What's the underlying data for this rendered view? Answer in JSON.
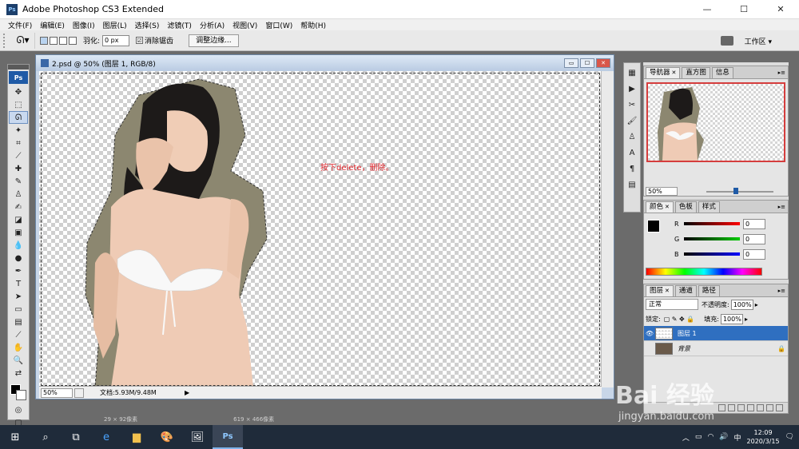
{
  "titlebar": {
    "app_title": "Adobe Photoshop CS3 Extended",
    "logo": "Ps",
    "minimize": "—",
    "maximize": "☐",
    "close": "✕"
  },
  "menu": [
    "文件(F)",
    "编辑(E)",
    "图像(I)",
    "图层(L)",
    "选择(S)",
    "滤镜(T)",
    "分析(A)",
    "视图(V)",
    "窗口(W)",
    "帮助(H)"
  ],
  "options": {
    "feather_label": "羽化:",
    "feather_value": "0 px",
    "antialias_label": "消除锯齿",
    "antialias_checked": "☑",
    "refine_edge": "调整边缘...",
    "workspace": "工作区 ▾"
  },
  "document": {
    "title": "2.psd @ 50% (图层 1, RGB/8)",
    "annotation": "按下delete，删除。",
    "zoom": "50%",
    "doc_info": "文档:5.93M/9.48M"
  },
  "panels": {
    "navigator": {
      "tabs": [
        "导航器",
        "直方图",
        "信息"
      ],
      "zoom": "50%"
    },
    "color": {
      "tabs": [
        "颜色",
        "色板",
        "样式"
      ],
      "channels": [
        {
          "label": "R",
          "value": "0",
          "color": "#cc0000"
        },
        {
          "label": "G",
          "value": "0",
          "color": "#00aa00"
        },
        {
          "label": "B",
          "value": "0",
          "color": "#0000cc"
        }
      ]
    },
    "layers": {
      "tabs": [
        "图层",
        "通道",
        "路径"
      ],
      "blend_mode": "正常",
      "opacity_label": "不透明度:",
      "opacity": "100%",
      "lock_label": "锁定:",
      "fill_label": "填充:",
      "fill": "100%",
      "items": [
        {
          "name": "图层 1",
          "visible": "👁"
        },
        {
          "name": "背景",
          "visible": ""
        }
      ]
    }
  },
  "ghost_bar": [
    "29 × 92像素",
    "619 × 466像素"
  ],
  "taskbar": {
    "ime": "中",
    "time": "12:09",
    "date": "2020/3/15"
  },
  "watermark": {
    "main": "Bai 经验",
    "sub": "jingyan.baidu.com"
  },
  "colors": {
    "accent": "#2f6fc0",
    "annotation": "#e0262c",
    "taskbar": "#1f2b3a"
  }
}
